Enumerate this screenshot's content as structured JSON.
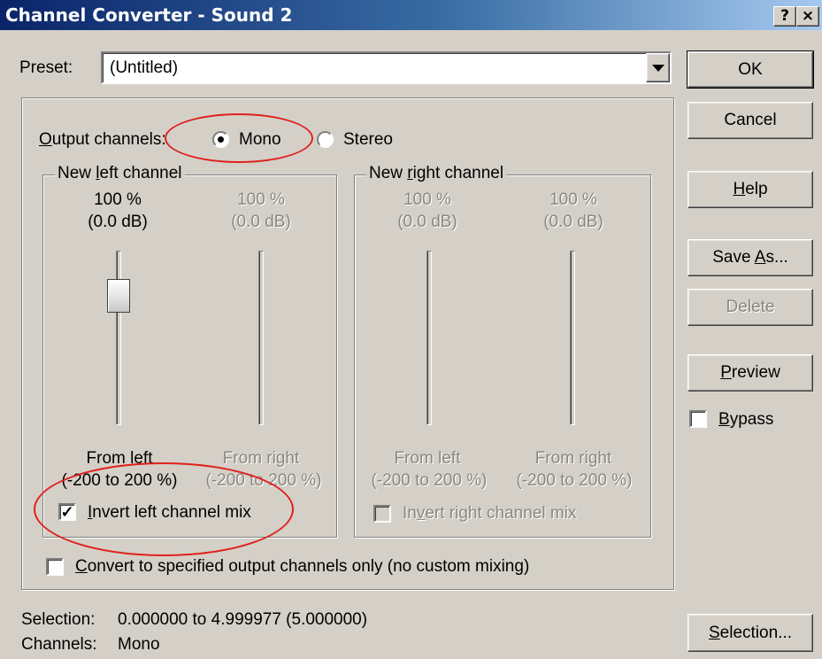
{
  "window": {
    "title": "Channel Converter - Sound 2",
    "help_btn": "?",
    "close_btn": "×"
  },
  "preset": {
    "label": "Preset:",
    "value": "(Untitled)"
  },
  "output": {
    "label_pre": "O",
    "label_post": "utput channels:",
    "mono": "Mono",
    "stereo": "Stereo",
    "selected": "Mono"
  },
  "left_group": {
    "title_pre": "New ",
    "title_u": "l",
    "title_post": "eft channel",
    "slider1": {
      "pct": "100 %",
      "db": "(0.0 dB)",
      "from": "From left",
      "range": "(-200 to 200 %)"
    },
    "slider2": {
      "pct": "100 %",
      "db": "(0.0 dB)",
      "from": "From right",
      "range": "(-200 to 200 %)"
    },
    "invert_pre": "",
    "invert_u": "I",
    "invert_post": "nvert left channel mix",
    "invert_checked": true
  },
  "right_group": {
    "title_pre": "New ",
    "title_u": "r",
    "title_post": "ight channel",
    "slider1": {
      "pct": "100 %",
      "db": "(0.0 dB)",
      "from": "From left",
      "range": "(-200 to 200 %)"
    },
    "slider2": {
      "pct": "100 %",
      "db": "(0.0 dB)",
      "from": "From right",
      "range": "(-200 to 200 %)"
    },
    "invert_pre": "In",
    "invert_u": "v",
    "invert_post": "ert right channel mix",
    "invert_checked": false
  },
  "convert_only": {
    "pre": "",
    "u": "C",
    "post": "onvert to specified output channels only (no custom mixing)",
    "checked": false
  },
  "buttons": {
    "ok": "OK",
    "cancel": "Cancel",
    "help_u": "H",
    "help_post": "elp",
    "saveas_pre": "Save ",
    "saveas_u": "A",
    "saveas_post": "s...",
    "delete": "Delete",
    "preview_u": "P",
    "preview_post": "review",
    "bypass_u": "B",
    "bypass_post": "ypass",
    "selection_u": "S",
    "selection_post": "election..."
  },
  "status": {
    "selection_label": "Selection:",
    "selection_value": "0.000000 to 4.999977 (5.000000)",
    "channels_label": "Channels:",
    "channels_value": "Mono"
  },
  "colors": {
    "title_start": "#0a246a",
    "title_end": "#a6caf0",
    "face": "#d4d0c8",
    "annotation": "#e0201c"
  }
}
